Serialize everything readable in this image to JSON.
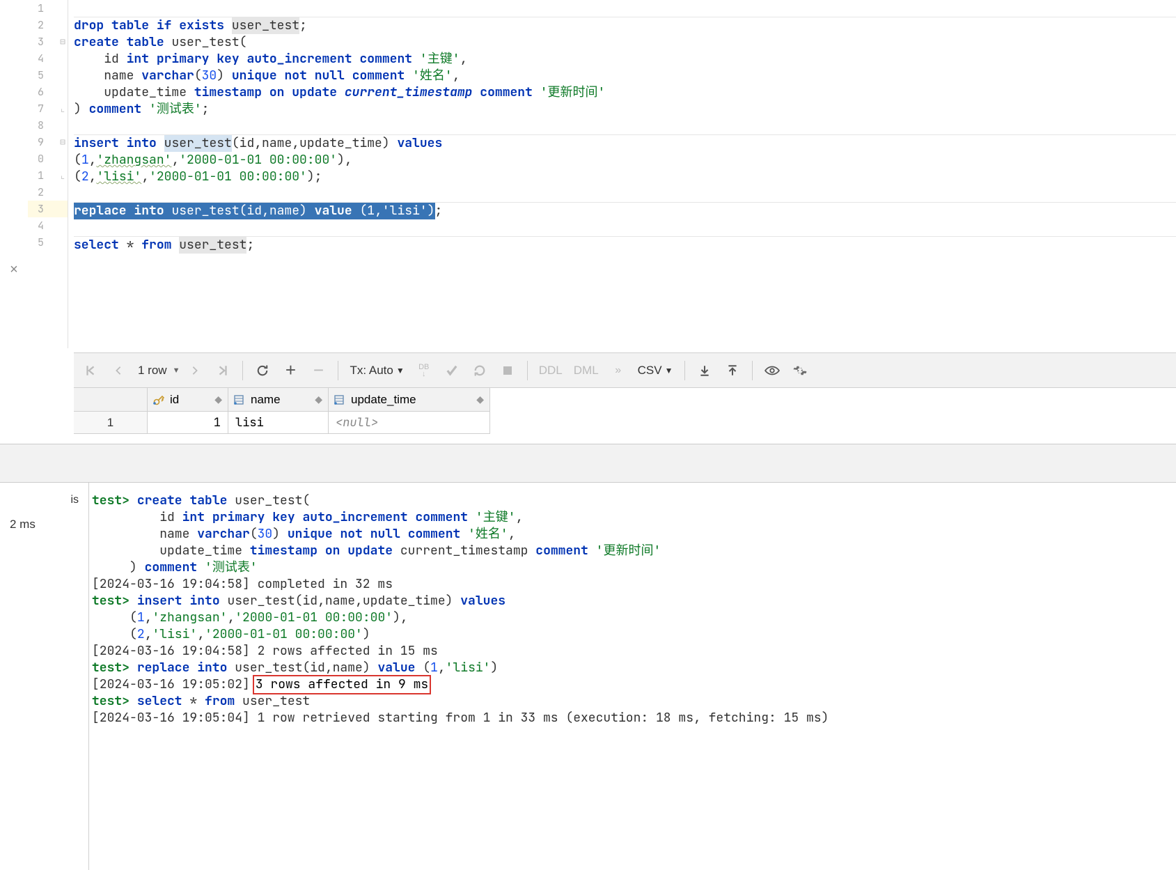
{
  "editor": {
    "gutter_lines": [
      "1",
      "2",
      "3",
      "4",
      "5",
      "6",
      "7",
      "8",
      "9",
      "0",
      "1",
      "2",
      "3",
      "4",
      "5"
    ],
    "active_line_index": 12,
    "lines": [
      {
        "tokens": [
          {
            "t": "",
            "c": "txt"
          }
        ]
      },
      {
        "indent_hl": false,
        "tokens": [
          {
            "t": "drop",
            "c": "kw"
          },
          {
            "t": " ",
            "c": "txt"
          },
          {
            "t": "table",
            "c": "kw"
          },
          {
            "t": " ",
            "c": "txt"
          },
          {
            "t": "if",
            "c": "kw"
          },
          {
            "t": " ",
            "c": "txt"
          },
          {
            "t": "exists",
            "c": "kw"
          },
          {
            "t": " ",
            "c": "txt"
          },
          {
            "t": "user_test",
            "c": "txt id-bg"
          },
          {
            "t": ";",
            "c": "punct"
          }
        ]
      },
      {
        "fold": "minus",
        "tokens": [
          {
            "t": "create",
            "c": "kw"
          },
          {
            "t": " ",
            "c": "txt"
          },
          {
            "t": "table",
            "c": "kw"
          },
          {
            "t": " ",
            "c": "txt"
          },
          {
            "t": "user_test",
            "c": "txt"
          },
          {
            "t": "(",
            "c": "punct"
          }
        ]
      },
      {
        "tokens": [
          {
            "t": "    id ",
            "c": "txt"
          },
          {
            "t": "int",
            "c": "kw"
          },
          {
            "t": " ",
            "c": "txt"
          },
          {
            "t": "primary",
            "c": "kw"
          },
          {
            "t": " ",
            "c": "txt"
          },
          {
            "t": "key",
            "c": "kw"
          },
          {
            "t": " ",
            "c": "txt"
          },
          {
            "t": "auto_increment",
            "c": "kw"
          },
          {
            "t": " ",
            "c": "txt"
          },
          {
            "t": "comment",
            "c": "kw"
          },
          {
            "t": " ",
            "c": "txt"
          },
          {
            "t": "'主键'",
            "c": "str"
          },
          {
            "t": ",",
            "c": "punct"
          }
        ]
      },
      {
        "tokens": [
          {
            "t": "    name ",
            "c": "txt"
          },
          {
            "t": "varchar",
            "c": "kw"
          },
          {
            "t": "(",
            "c": "punct"
          },
          {
            "t": "30",
            "c": "num"
          },
          {
            "t": ") ",
            "c": "punct"
          },
          {
            "t": "unique",
            "c": "kw"
          },
          {
            "t": " ",
            "c": "txt"
          },
          {
            "t": "not",
            "c": "kw"
          },
          {
            "t": " ",
            "c": "txt"
          },
          {
            "t": "null",
            "c": "kw"
          },
          {
            "t": " ",
            "c": "txt"
          },
          {
            "t": "comment",
            "c": "kw"
          },
          {
            "t": " ",
            "c": "txt"
          },
          {
            "t": "'姓名'",
            "c": "str"
          },
          {
            "t": ",",
            "c": "punct"
          }
        ]
      },
      {
        "tokens": [
          {
            "t": "    update_time ",
            "c": "txt"
          },
          {
            "t": "timestamp",
            "c": "kw"
          },
          {
            "t": " ",
            "c": "txt"
          },
          {
            "t": "on",
            "c": "kw"
          },
          {
            "t": " ",
            "c": "txt"
          },
          {
            "t": "update",
            "c": "kw"
          },
          {
            "t": " ",
            "c": "txt"
          },
          {
            "t": "current_timestamp",
            "c": "kw ital"
          },
          {
            "t": " ",
            "c": "txt"
          },
          {
            "t": "comment",
            "c": "kw"
          },
          {
            "t": " ",
            "c": "txt"
          },
          {
            "t": "'更新时间'",
            "c": "str"
          }
        ]
      },
      {
        "fold": "end",
        "tokens": [
          {
            "t": ") ",
            "c": "punct"
          },
          {
            "t": "comment",
            "c": "kw"
          },
          {
            "t": " ",
            "c": "txt"
          },
          {
            "t": "'测试表'",
            "c": "str"
          },
          {
            "t": ";",
            "c": "punct"
          }
        ]
      },
      {
        "tokens": [
          {
            "t": "",
            "c": "txt"
          }
        ]
      },
      {
        "fold": "minus",
        "tokens": [
          {
            "t": "insert",
            "c": "kw"
          },
          {
            "t": " ",
            "c": "txt"
          },
          {
            "t": "into",
            "c": "kw"
          },
          {
            "t": " ",
            "c": "txt"
          },
          {
            "t": "user_test",
            "c": "txt id-bg2"
          },
          {
            "t": "(id,name,update_time) ",
            "c": "txt"
          },
          {
            "t": "values",
            "c": "kw"
          }
        ]
      },
      {
        "tokens": [
          {
            "t": "(",
            "c": "punct"
          },
          {
            "t": "1",
            "c": "num"
          },
          {
            "t": ",",
            "c": "punct"
          },
          {
            "t": "'zhangsan'",
            "c": "str wavy-underline"
          },
          {
            "t": ",",
            "c": "punct"
          },
          {
            "t": "'2000-01-01 00:00:00'",
            "c": "str"
          },
          {
            "t": "),",
            "c": "punct"
          }
        ]
      },
      {
        "fold": "end",
        "tokens": [
          {
            "t": "(",
            "c": "punct"
          },
          {
            "t": "2",
            "c": "num"
          },
          {
            "t": ",",
            "c": "punct"
          },
          {
            "t": "'lisi'",
            "c": "str wavy-underline"
          },
          {
            "t": ",",
            "c": "punct"
          },
          {
            "t": "'2000-01-01 00:00:00'",
            "c": "str"
          },
          {
            "t": ");",
            "c": "punct"
          }
        ]
      },
      {
        "tokens": [
          {
            "t": "",
            "c": "txt"
          }
        ]
      },
      {
        "selected": true,
        "tokens": [
          {
            "t": "replace",
            "c": "kw"
          },
          {
            "t": " ",
            "c": "txt"
          },
          {
            "t": "into",
            "c": "kw"
          },
          {
            "t": " ",
            "c": "txt"
          },
          {
            "t": "user_test(id,name) ",
            "c": "txt"
          },
          {
            "t": "value",
            "c": "kw"
          },
          {
            "t": " (",
            "c": "punct"
          },
          {
            "t": "1",
            "c": "num"
          },
          {
            "t": ",",
            "c": "punct"
          },
          {
            "t": "'lisi'",
            "c": "str"
          },
          {
            "t": ")",
            "c": "punct"
          }
        ],
        "after": ";"
      },
      {
        "tokens": [
          {
            "t": "",
            "c": "txt"
          }
        ]
      },
      {
        "tokens": [
          {
            "t": "select",
            "c": "kw"
          },
          {
            "t": " * ",
            "c": "txt"
          },
          {
            "t": "from",
            "c": "kw"
          },
          {
            "t": " ",
            "c": "txt"
          },
          {
            "t": "user_test",
            "c": "txt id-bg"
          },
          {
            "t": ";",
            "c": "punct"
          }
        ]
      }
    ]
  },
  "toolbar": {
    "row_count": "1 row",
    "tx": "Tx: Auto",
    "ddl": "DDL",
    "dml": "DML",
    "csv": "CSV"
  },
  "results": {
    "columns": [
      "id",
      "name",
      "update_time"
    ],
    "rows": [
      {
        "n": "1",
        "id": "1",
        "name": "lisi",
        "update_time": "<null>"
      }
    ]
  },
  "console_left": {
    "item1": "is",
    "item2": "2 ms"
  },
  "console": [
    {
      "type": "prompt",
      "prompt": "test>",
      "tokens": [
        {
          "t": " ",
          "c": "txt"
        },
        {
          "t": "create",
          "c": "kw"
        },
        {
          "t": " ",
          "c": "txt"
        },
        {
          "t": "table",
          "c": "kw"
        },
        {
          "t": " user_test(",
          "c": "txt"
        }
      ]
    },
    {
      "type": "cont",
      "tokens": [
        {
          "t": "         id ",
          "c": "txt"
        },
        {
          "t": "int",
          "c": "kw"
        },
        {
          "t": " ",
          "c": "txt"
        },
        {
          "t": "primary",
          "c": "kw"
        },
        {
          "t": " ",
          "c": "txt"
        },
        {
          "t": "key",
          "c": "kw"
        },
        {
          "t": " ",
          "c": "txt"
        },
        {
          "t": "auto_increment",
          "c": "kw"
        },
        {
          "t": " ",
          "c": "txt"
        },
        {
          "t": "comment ",
          "c": "kw"
        },
        {
          "t": "'主键'",
          "c": "str"
        },
        {
          "t": ",",
          "c": "txt"
        }
      ]
    },
    {
      "type": "cont",
      "tokens": [
        {
          "t": "         name ",
          "c": "txt"
        },
        {
          "t": "varchar",
          "c": "kw"
        },
        {
          "t": "(",
          "c": "txt"
        },
        {
          "t": "30",
          "c": "num"
        },
        {
          "t": ") ",
          "c": "txt"
        },
        {
          "t": "unique",
          "c": "kw"
        },
        {
          "t": " ",
          "c": "txt"
        },
        {
          "t": "not",
          "c": "kw"
        },
        {
          "t": " ",
          "c": "txt"
        },
        {
          "t": "null",
          "c": "kw"
        },
        {
          "t": " ",
          "c": "txt"
        },
        {
          "t": "comment ",
          "c": "kw"
        },
        {
          "t": "'姓名'",
          "c": "str"
        },
        {
          "t": ",",
          "c": "txt"
        }
      ]
    },
    {
      "type": "cont",
      "tokens": [
        {
          "t": "         update_time ",
          "c": "txt"
        },
        {
          "t": "timestamp",
          "c": "kw"
        },
        {
          "t": " ",
          "c": "txt"
        },
        {
          "t": "on",
          "c": "kw"
        },
        {
          "t": " ",
          "c": "txt"
        },
        {
          "t": "update",
          "c": "kw"
        },
        {
          "t": " current_timestamp ",
          "c": "txt"
        },
        {
          "t": "comment ",
          "c": "kw"
        },
        {
          "t": "'更新时间'",
          "c": "str"
        }
      ]
    },
    {
      "type": "cont",
      "tokens": [
        {
          "t": "     ) ",
          "c": "txt"
        },
        {
          "t": "comment ",
          "c": "kw"
        },
        {
          "t": "'测试表'",
          "c": "str"
        }
      ]
    },
    {
      "type": "log",
      "text": "[2024-03-16 19:04:58] completed in 32 ms"
    },
    {
      "type": "prompt",
      "prompt": "test>",
      "tokens": [
        {
          "t": " ",
          "c": "txt"
        },
        {
          "t": "insert",
          "c": "kw"
        },
        {
          "t": " ",
          "c": "txt"
        },
        {
          "t": "into",
          "c": "kw"
        },
        {
          "t": " user_test(id,name,update_time) ",
          "c": "txt"
        },
        {
          "t": "values",
          "c": "kw"
        }
      ]
    },
    {
      "type": "cont",
      "tokens": [
        {
          "t": "     (",
          "c": "txt"
        },
        {
          "t": "1",
          "c": "num"
        },
        {
          "t": ",",
          "c": "txt"
        },
        {
          "t": "'zhangsan'",
          "c": "str"
        },
        {
          "t": ",",
          "c": "txt"
        },
        {
          "t": "'2000-01-01 00:00:00'",
          "c": "str"
        },
        {
          "t": "),",
          "c": "txt"
        }
      ]
    },
    {
      "type": "cont",
      "tokens": [
        {
          "t": "     (",
          "c": "txt"
        },
        {
          "t": "2",
          "c": "num"
        },
        {
          "t": ",",
          "c": "txt"
        },
        {
          "t": "'lisi'",
          "c": "str"
        },
        {
          "t": ",",
          "c": "txt"
        },
        {
          "t": "'2000-01-01 00:00:00'",
          "c": "str"
        },
        {
          "t": ")",
          "c": "txt"
        }
      ]
    },
    {
      "type": "log",
      "text": "[2024-03-16 19:04:58] 2 rows affected in 15 ms"
    },
    {
      "type": "prompt",
      "prompt": "test>",
      "tokens": [
        {
          "t": " ",
          "c": "txt"
        },
        {
          "t": "replace",
          "c": "kw"
        },
        {
          "t": " ",
          "c": "txt"
        },
        {
          "t": "into",
          "c": "kw"
        },
        {
          "t": " user_test(id,name) ",
          "c": "txt"
        },
        {
          "t": "value",
          "c": "kw"
        },
        {
          "t": " (",
          "c": "txt"
        },
        {
          "t": "1",
          "c": "num"
        },
        {
          "t": ",",
          "c": "txt"
        },
        {
          "t": "'lisi'",
          "c": "str"
        },
        {
          "t": ")",
          "c": "txt"
        }
      ]
    },
    {
      "type": "log_hl",
      "ts": "[2024-03-16 19:05:02]",
      "hl": "3 rows affected in 9 ms"
    },
    {
      "type": "prompt",
      "prompt": "test>",
      "tokens": [
        {
          "t": " ",
          "c": "txt"
        },
        {
          "t": "select",
          "c": "kw"
        },
        {
          "t": " * ",
          "c": "txt"
        },
        {
          "t": "from",
          "c": "kw"
        },
        {
          "t": " user_test",
          "c": "txt"
        }
      ]
    },
    {
      "type": "log",
      "text": "[2024-03-16 19:05:04] 1 row retrieved starting from 1 in 33 ms (execution: 18 ms, fetching: 15 ms)"
    }
  ]
}
